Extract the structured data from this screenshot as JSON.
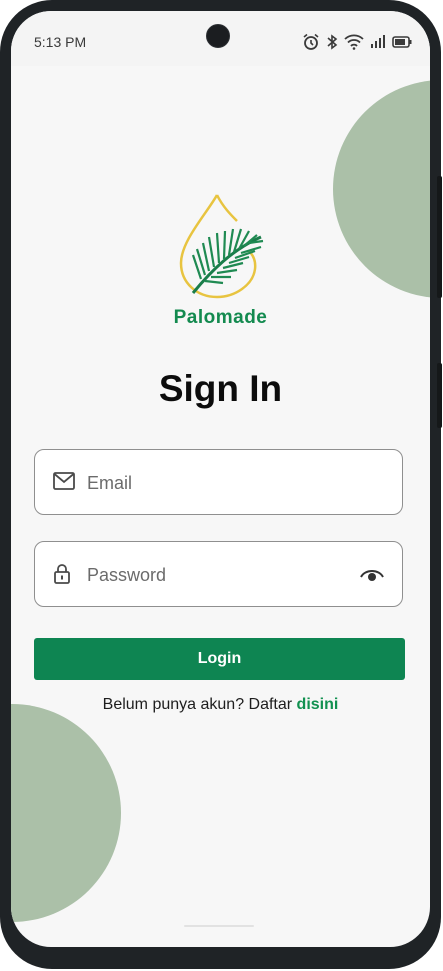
{
  "status_bar": {
    "time": "5:13 PM",
    "icons": [
      "alarm-icon",
      "bluetooth-icon",
      "wifi-icon",
      "signal-icon",
      "battery-icon"
    ]
  },
  "brand": {
    "name": "Palomade",
    "logo": "palm-leaf-drop-logo"
  },
  "page": {
    "title": "Sign In"
  },
  "form": {
    "email_placeholder": "Email",
    "password_placeholder": "Password",
    "login_label": "Login"
  },
  "register": {
    "prompt": "Belum punya akun? Daftar ",
    "link_label": "disini"
  },
  "colors": {
    "primary": "#0e8552",
    "decor_circle": "#abc0a8",
    "background": "#f7f7f7",
    "logo_drop": "#e8c440"
  }
}
